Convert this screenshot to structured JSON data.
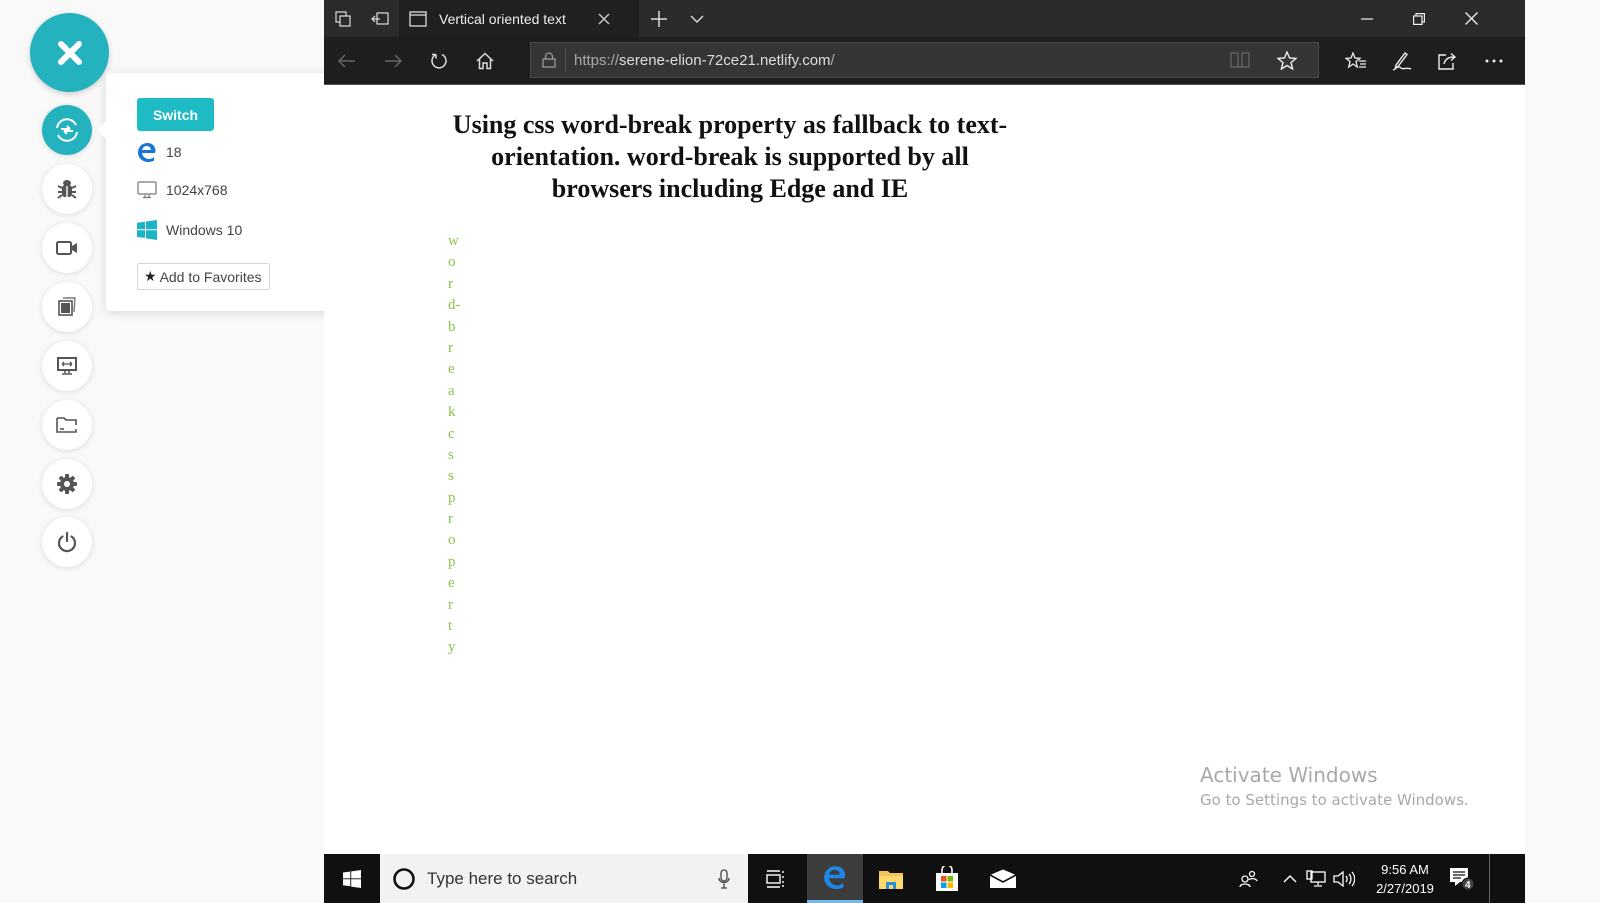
{
  "rail": {
    "close_icon": "close-icon",
    "items": [
      {
        "name": "switch-browser",
        "icon": "switch-icon",
        "active": true
      },
      {
        "name": "bug-report",
        "icon": "bug-icon",
        "active": false
      },
      {
        "name": "record-video",
        "icon": "video-camera-icon",
        "active": false
      },
      {
        "name": "screenshot-gallery",
        "icon": "gallery-icon",
        "active": false
      },
      {
        "name": "screen-resolution",
        "icon": "monitor-resize-icon",
        "active": false
      },
      {
        "name": "file-manager",
        "icon": "folder-icon",
        "active": false
      },
      {
        "name": "settings",
        "icon": "gear-icon",
        "active": false
      },
      {
        "name": "power-end-session",
        "icon": "power-icon",
        "active": false
      }
    ]
  },
  "popup": {
    "switch_label": "Switch",
    "browser_version": "18",
    "resolution": "1024x768",
    "os": "Windows 10",
    "favorites_label": "Add to Favorites",
    "accent": "#1ebbc5"
  },
  "browser": {
    "tab_title": "Vertical oriented text",
    "url_protocol": "https://",
    "url_host": "serene-elion-72ce21.netlify.com",
    "url_path": "/"
  },
  "page": {
    "heading": "Using css word-break property as fallback to text-orientation. word-break is supported by all browsers including Edge and IE",
    "vertical_letters": [
      "w",
      "o",
      "r",
      "d-",
      "b",
      "r",
      "e",
      "a",
      "k",
      "c",
      "s",
      "s",
      "p",
      "r",
      "o",
      "p",
      "e",
      "r",
      "t",
      "y"
    ],
    "vertical_color": "#8bc34a",
    "activate_title": "Activate Windows",
    "activate_subtitle": "Go to Settings to activate Windows."
  },
  "taskbar": {
    "search_placeholder": "Type here to search",
    "time": "9:56 AM",
    "date": "2/27/2019",
    "notification_count": "4"
  }
}
